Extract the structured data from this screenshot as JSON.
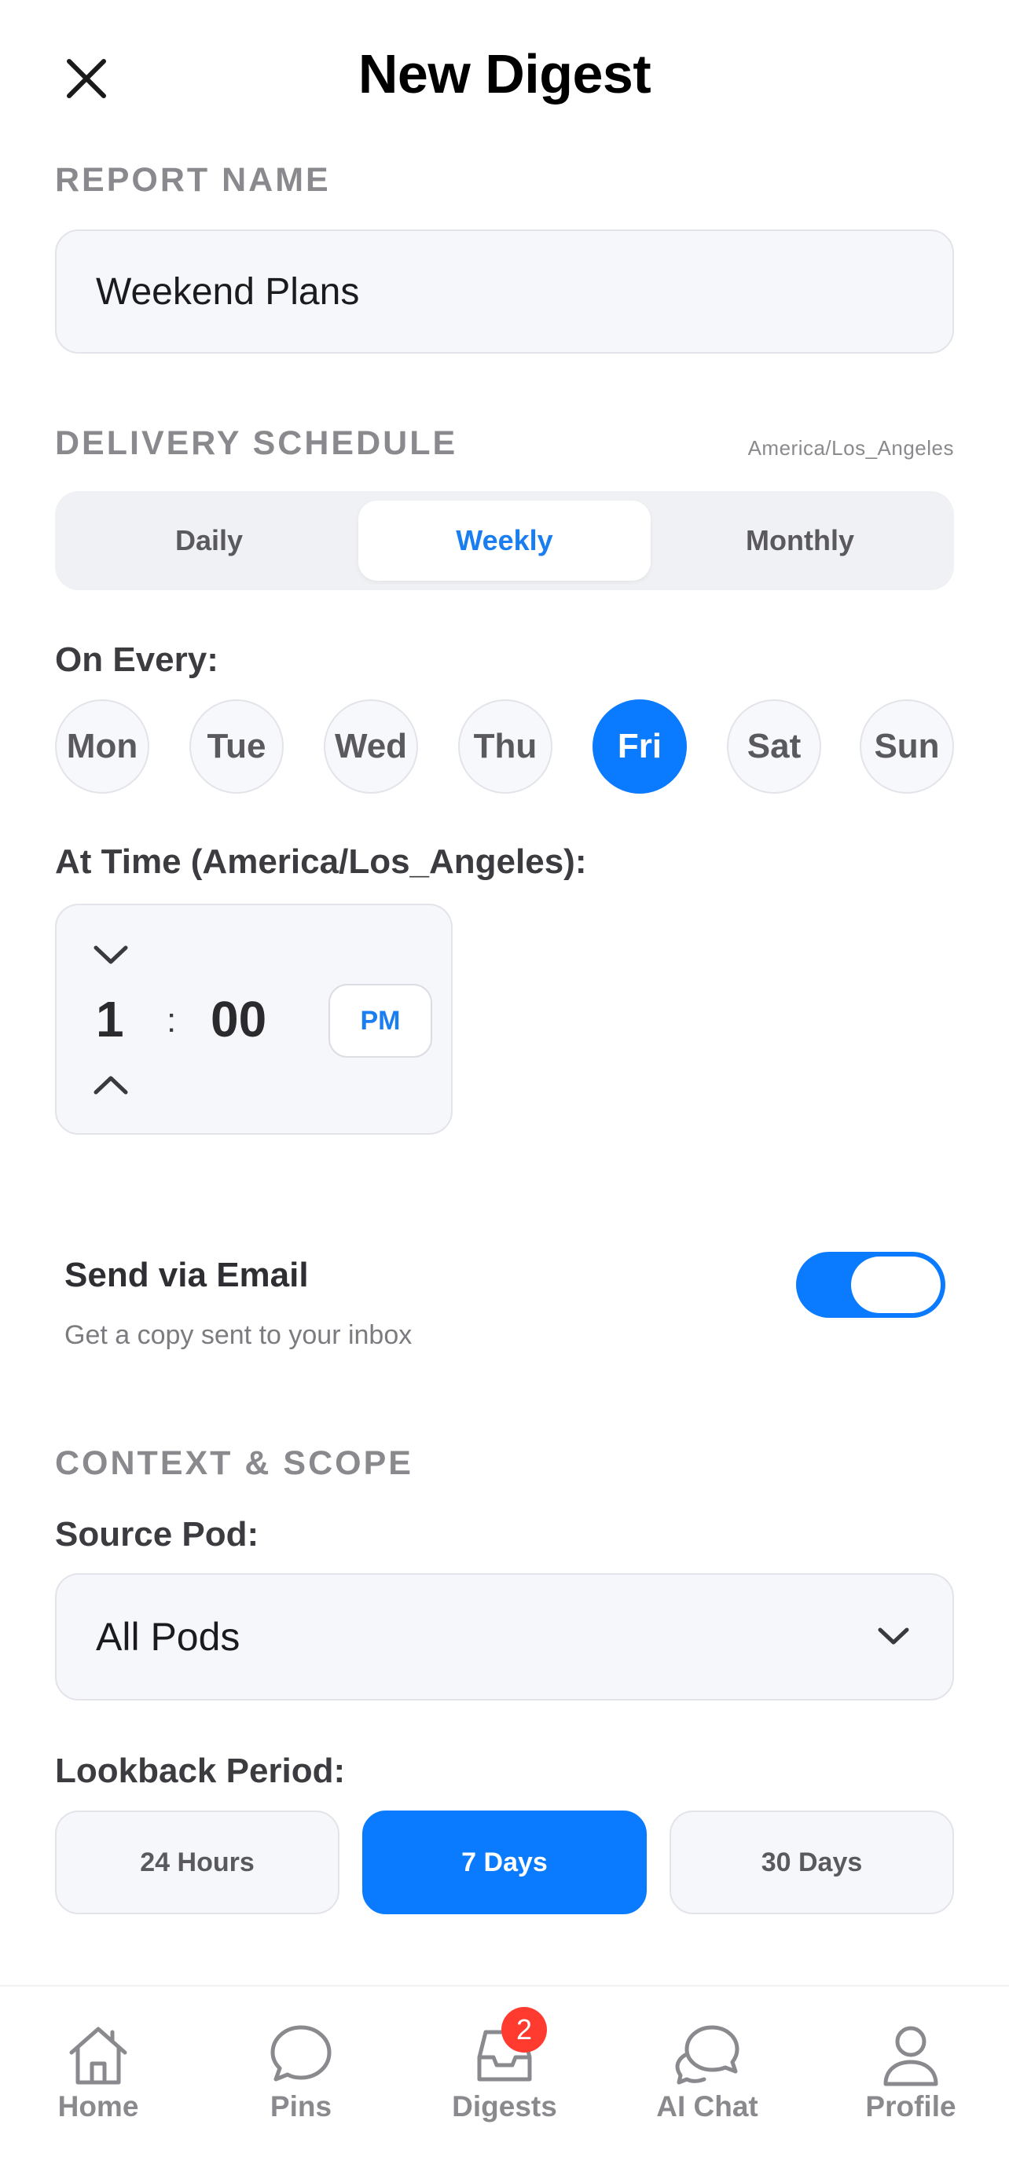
{
  "header": {
    "title": "New Digest",
    "close_icon": "close-icon"
  },
  "report_name": {
    "section_label": "REPORT NAME",
    "value": "Weekend Plans"
  },
  "delivery": {
    "section_label": "DELIVERY SCHEDULE",
    "timezone": "America/Los_Angeles",
    "frequency_options": [
      "Daily",
      "Weekly",
      "Monthly"
    ],
    "frequency_selected": "Weekly",
    "on_every_label": "On Every:",
    "days": [
      "Mon",
      "Tue",
      "Wed",
      "Thu",
      "Fri",
      "Sat",
      "Sun"
    ],
    "day_selected": "Fri",
    "at_time_label": "At Time (America/Los_Angeles):",
    "hour": "1",
    "separator": ":",
    "minute": "00",
    "ampm": "PM"
  },
  "email": {
    "title": "Send via Email",
    "subtitle": "Get a copy sent to your inbox",
    "enabled": true
  },
  "context": {
    "section_label": "CONTEXT & SCOPE",
    "source_pod_label": "Source Pod:",
    "source_pod_value": "All Pods",
    "lookback_label": "Lookback Period:",
    "lookback_options": [
      "24 Hours",
      "7 Days",
      "30 Days"
    ],
    "lookback_selected": "7 Days"
  },
  "tabbar": {
    "items": [
      {
        "label": "Home",
        "icon": "home-icon"
      },
      {
        "label": "Pins",
        "icon": "chat-bubble-icon"
      },
      {
        "label": "Digests",
        "icon": "inbox-tray-icon",
        "badge": "2"
      },
      {
        "label": "AI Chat",
        "icon": "chat-bubbles-icon"
      },
      {
        "label": "Profile",
        "icon": "person-icon"
      }
    ]
  },
  "colors": {
    "accent": "#0a7aff",
    "badge": "#ff3b30",
    "muted_text": "#8a8a8e"
  }
}
